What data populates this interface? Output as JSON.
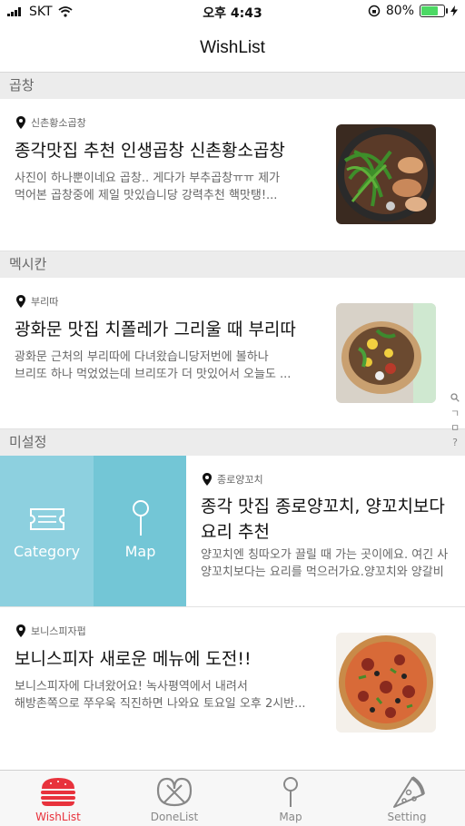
{
  "status": {
    "carrier": "SKT",
    "time": "오후 4:43",
    "battery": "80%",
    "battery_level": 0.8
  },
  "navbar": {
    "title": "WishList"
  },
  "sections": [
    {
      "label": "곱창"
    },
    {
      "label": "멕시칸"
    },
    {
      "label": "미설정"
    }
  ],
  "items": [
    {
      "location": "신촌황소곱창",
      "title": "종각맛집 추천 인생곱창 신촌황소곱창",
      "desc_line1": "사진이 하나뿐이네요 곱창.. 게다가 부추곱창ㅠㅠ 제가",
      "desc_line2": "먹어본 곱창중에 제일 맛있습니당 강력추천 핵맛탱!..."
    },
    {
      "location": "부리따",
      "title": "광화문 맛집 치폴레가 그리울 때 부리따",
      "desc_line1": "광화문 근처의 부리따에 다녀왔습니당저번에 볼하나",
      "desc_line2": "브리또 하나 먹었었는데 브리또가 더 맛있어서 오늘도 ..."
    },
    {
      "location": "종로양꼬치",
      "title_line1": "종각 맛집 종로양꼬치, 양꼬치보다",
      "title_line2": "요리 추천",
      "desc_line1": "양꼬치엔 칭따오가 끌릴 때 가는 곳이에요. 여긴 사",
      "desc_line2": "양꼬치보다는 요리를 먹으러가요.양꼬치와 양갈비"
    },
    {
      "location": "보니스피자펍",
      "title": "보니스피자 새로운 메뉴에 도전!!",
      "desc_line1": "보니스피자에 다녀왔어요! 녹사평역에서 내려서",
      "desc_line2": "해방촌쪽으로 쭈우욱 직진하면 나와요 토요일 오후 2시반..."
    }
  ],
  "swipe_actions": {
    "category": "Category",
    "map": "Map"
  },
  "section_index": [
    "ㄱ",
    "ㅁ",
    "?"
  ],
  "tabs": [
    {
      "label": "WishList",
      "active": true
    },
    {
      "label": "DoneList",
      "active": false
    },
    {
      "label": "Map",
      "active": false
    },
    {
      "label": "Setting",
      "active": false
    }
  ],
  "colors": {
    "accent": "#e8323c",
    "action_category": "#8dd0df",
    "action_map": "#73c6d6",
    "section_bg": "#ececec"
  }
}
